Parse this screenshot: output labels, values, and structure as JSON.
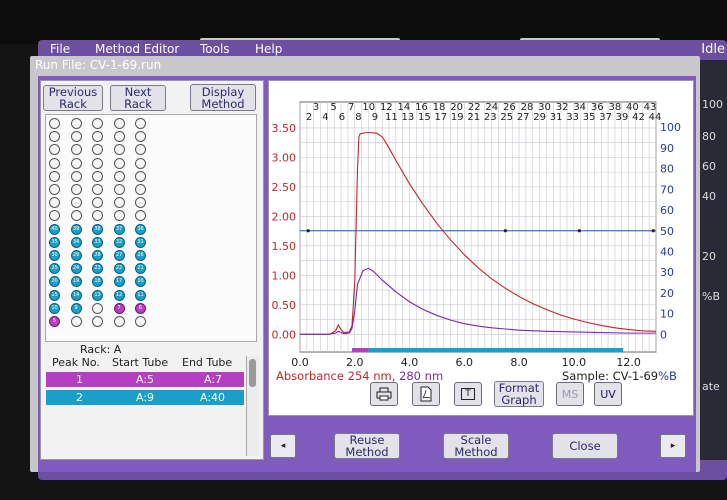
{
  "window": {
    "menu": {
      "file": "File",
      "method_editor": "Method Editor",
      "tools": "Tools",
      "help": "Help"
    },
    "status": "Idle",
    "dialog_title": "Run File: CV-1-69.run"
  },
  "right_strip": {
    "labels": [
      "100",
      "80",
      "60",
      "40",
      "20",
      "%B",
      "ate"
    ]
  },
  "rack_nav": {
    "previous": "Previous Rack",
    "next": "Next Rack",
    "display_method": "Display Method"
  },
  "rack": {
    "label": "Rack: A",
    "columns": 5,
    "rows": 16,
    "filled_blue": [
      "40",
      "39",
      "38",
      "37",
      "36",
      "35",
      "34",
      "33",
      "32",
      "31",
      "30",
      "29",
      "28",
      "27",
      "26",
      "25",
      "24",
      "23",
      "22",
      "21",
      "20",
      "19",
      "18",
      "17",
      "16",
      "15",
      "14",
      "13",
      "12",
      "11",
      "10",
      "9"
    ],
    "filled_magenta": [
      "7",
      "6",
      "5"
    ]
  },
  "peaks": {
    "headers": {
      "peak_no": "Peak No.",
      "start_tube": "Start Tube",
      "end_tube": "End Tube"
    },
    "rows": [
      {
        "no": "1",
        "start": "A:5",
        "end": "A:7",
        "color": "#b43fc0"
      },
      {
        "no": "2",
        "start": "A:9",
        "end": "A:40",
        "color": "#1aa0c8"
      }
    ]
  },
  "chart_data": {
    "type": "line",
    "xlim": [
      0,
      13
    ],
    "ylim": [
      -0.3,
      3.6
    ],
    "y2lim": [
      -8.5,
      102.5
    ],
    "x_ticks": [
      "0.0",
      "2.0",
      "4.0",
      "6.0",
      "8.0",
      "10.0",
      "12.0"
    ],
    "y_ticks": [
      "0.00",
      "0.50",
      "1.00",
      "1.50",
      "2.00",
      "2.50",
      "3.00",
      "3.50"
    ],
    "y2_ticks": [
      "0",
      "10",
      "20",
      "30",
      "40",
      "50",
      "60",
      "70",
      "80",
      "90",
      "100"
    ],
    "tube_labels_top": [
      "3",
      "5",
      "7",
      "10",
      "12",
      "14",
      "16",
      "18",
      "20",
      "22",
      "24",
      "26",
      "28",
      "30",
      "32",
      "34",
      "36",
      "38",
      "40",
      "43"
    ],
    "tube_labels_bottom": [
      "2",
      "4",
      "6",
      "8",
      "9",
      "11",
      "13",
      "15",
      "17",
      "19",
      "21",
      "23",
      "25",
      "27",
      "29",
      "31",
      "33",
      "35",
      "37",
      "39",
      "42",
      "44"
    ],
    "legend_prefix": "Absorbance",
    "legend_254": "254 nm,",
    "legend_280": "280 nm",
    "sample_label": "Sample: CV-1-69",
    "percent_b_label": "%B",
    "series": [
      {
        "name": "254 nm",
        "color": "#c0262a",
        "x": [
          0.0,
          1.0,
          1.1,
          1.3,
          1.4,
          1.5,
          1.6,
          1.8,
          1.9,
          2.0,
          2.1,
          2.15,
          2.2,
          2.4,
          2.6,
          2.8,
          3.0,
          3.2,
          3.5,
          4.0,
          4.5,
          5.0,
          5.5,
          6.0,
          6.5,
          7.0,
          7.5,
          8.0,
          8.5,
          9.0,
          9.5,
          10.0,
          10.5,
          11.0,
          11.5,
          12.0,
          12.5,
          13.0
        ],
        "y": [
          0.0,
          0.0,
          0.0,
          0.06,
          0.16,
          0.08,
          0.03,
          0.04,
          0.15,
          0.9,
          2.8,
          3.35,
          3.4,
          3.42,
          3.42,
          3.41,
          3.35,
          3.2,
          2.95,
          2.55,
          2.2,
          1.88,
          1.6,
          1.35,
          1.13,
          0.94,
          0.78,
          0.64,
          0.52,
          0.42,
          0.33,
          0.26,
          0.2,
          0.15,
          0.11,
          0.08,
          0.06,
          0.05
        ]
      },
      {
        "name": "280 nm",
        "color": "#7a2aa8",
        "x": [
          0.0,
          1.0,
          1.3,
          1.4,
          1.5,
          1.6,
          1.8,
          1.9,
          2.0,
          2.1,
          2.3,
          2.5,
          2.7,
          3.0,
          3.5,
          4.0,
          4.5,
          5.0,
          5.5,
          6.0,
          6.5,
          7.0,
          7.5,
          8.0,
          9.0,
          10.0,
          11.0,
          12.0,
          13.0
        ],
        "y": [
          0.0,
          0.0,
          0.02,
          0.05,
          0.03,
          0.01,
          0.02,
          0.1,
          0.4,
          0.85,
          1.08,
          1.12,
          1.06,
          0.92,
          0.72,
          0.55,
          0.42,
          0.32,
          0.24,
          0.18,
          0.14,
          0.11,
          0.09,
          0.07,
          0.05,
          0.04,
          0.03,
          0.02,
          0.02
        ]
      },
      {
        "name": "%B",
        "color": "#2a5ab8",
        "x": [
          0.0,
          13.0
        ],
        "y": [
          50,
          50
        ]
      }
    ],
    "fraction_bars": [
      {
        "x0": 1.9,
        "x1": 2.5,
        "color": "#b43fc0"
      },
      {
        "x0": 2.5,
        "x1": 11.8,
        "color": "#1aa0c8"
      }
    ]
  },
  "chart_buttons": {
    "format_graph": "Format Graph",
    "ms": "MS",
    "uv": "UV",
    "text_icon_glyph": "T"
  },
  "bottom": {
    "reuse_method": "Reuse Method",
    "scale_method": "Scale Method",
    "close": "Close",
    "prev_glyph": "◂",
    "next_glyph": "▸"
  }
}
